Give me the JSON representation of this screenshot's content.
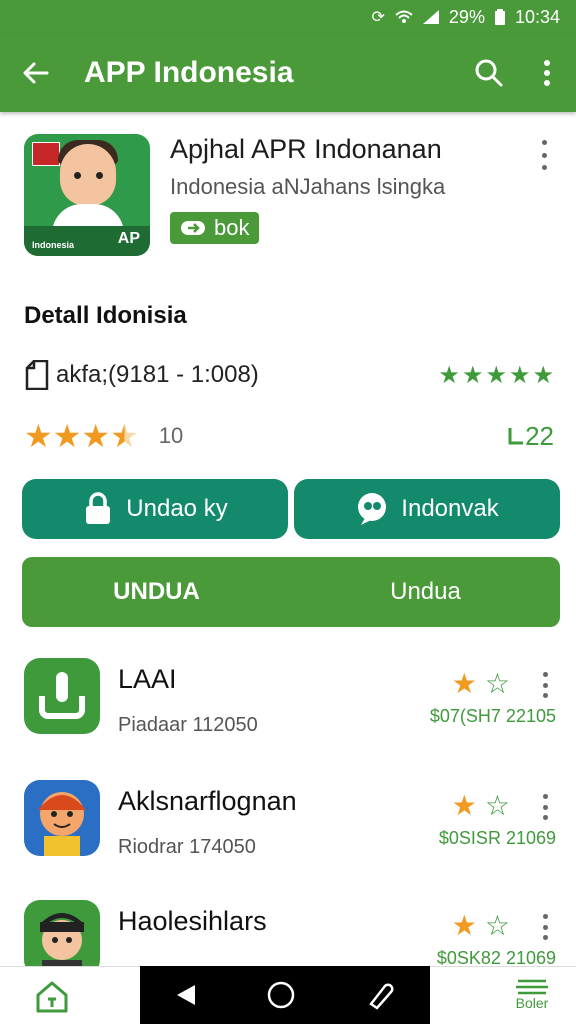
{
  "status": {
    "battery": "29%",
    "time": "10:34"
  },
  "appbar": {
    "title": "APP Indonesia"
  },
  "header": {
    "title": "Apjhal APR Indonanan",
    "subtitle": "Indonesia aNJahans lsingka",
    "badge": "bok",
    "icon_number": "AP",
    "icon_label": "Indonesia"
  },
  "section": {
    "title": "Detall Idonisia"
  },
  "info": {
    "text": "akfa;(9181 - 1:008)",
    "stars": 5
  },
  "rating": {
    "value": 3.5,
    "count": "10",
    "right": "22"
  },
  "buttons": {
    "left": "Undao ky",
    "right": "Indonvak"
  },
  "bigbutton": {
    "left": "UNDUA",
    "right": "Undua"
  },
  "list": [
    {
      "title": "LAAI",
      "subtitle": "Piadaar 112050",
      "price": "$07(SH7 22105",
      "rating": 1
    },
    {
      "title": "Aklsnarflognan",
      "subtitle": "Riodrar 174050",
      "price": "$0SISR 21069",
      "rating": 1
    },
    {
      "title": "Haolesihlars",
      "subtitle": "",
      "price": "$0SK82 21069",
      "rating": 1
    }
  ],
  "bottomnav": {
    "right_label": "Boler"
  },
  "colors": {
    "primary": "#4a9a3a",
    "teal": "#138a6b",
    "star": "#f29a1f"
  }
}
